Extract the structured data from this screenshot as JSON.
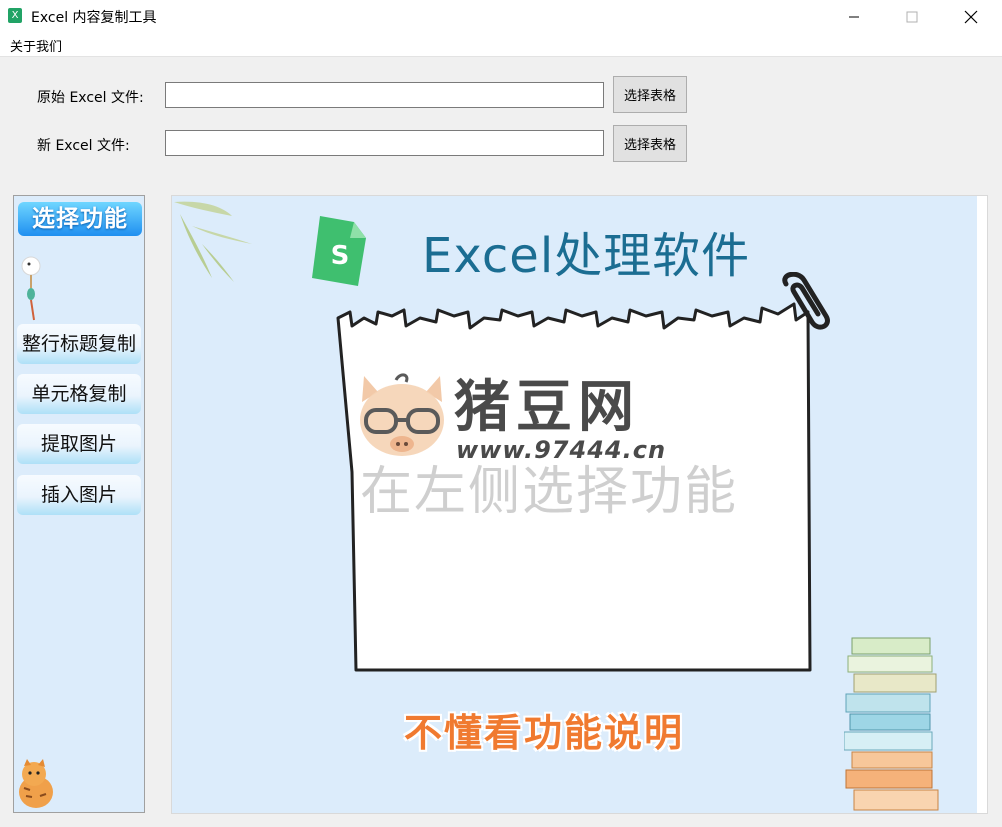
{
  "window": {
    "title": "Excel 内容复制工具",
    "app_icon_letter": "X",
    "controls": [
      "minimize-icon",
      "maximize-icon",
      "close-icon"
    ]
  },
  "menubar": {
    "items": [
      "关于我们"
    ]
  },
  "files": {
    "original_label": "原始 Excel 文件:",
    "original_value": "",
    "new_label": "新 Excel 文件:",
    "new_value": "",
    "pick_button_label": "选择表格"
  },
  "sidebar": {
    "title": "选择功能",
    "buttons": [
      "整行标题复制",
      "单元格复制",
      "提取图片",
      "插入图片"
    ],
    "decorations": [
      "pendant-icon",
      "tiger-icon"
    ]
  },
  "canvas": {
    "banner_title": "Excel处理软件",
    "badge_letter": "S",
    "hint": "在左侧选择功能",
    "help_link": "不懂看功能说明",
    "watermark_name": "猪豆网",
    "watermark_url": "www.97444.cn",
    "decorations": [
      "bamboo-leaf-icon",
      "sheet-badge-icon",
      "paper-clip-icon",
      "book-stack-icon",
      "pig-face-icon"
    ]
  },
  "colors": {
    "panel_bg": "#dcecfb",
    "title_blue": "#1b6d92",
    "help_orange": "#f07a30",
    "side_title_blue": "#1f8ff0",
    "excel_green": "#21a366"
  }
}
